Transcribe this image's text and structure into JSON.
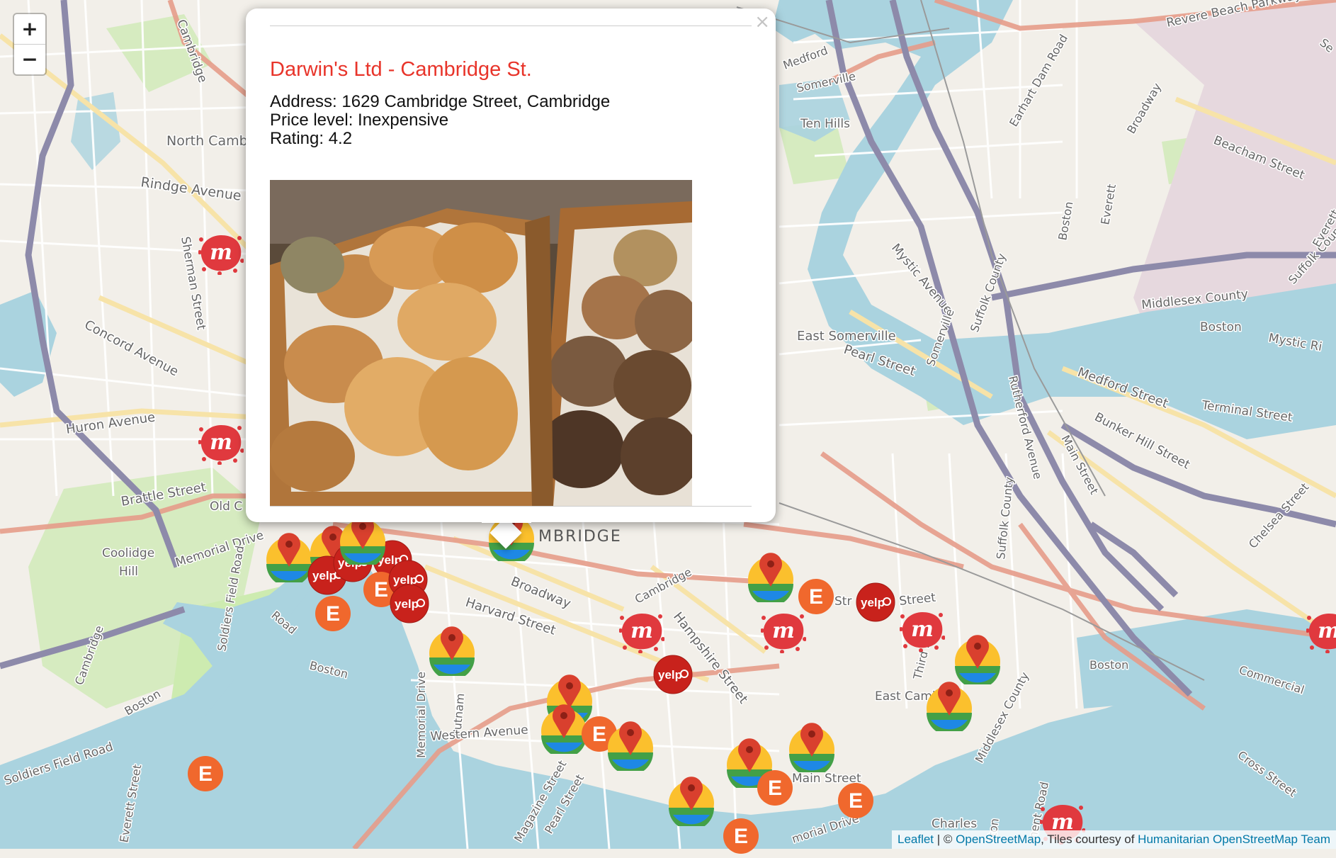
{
  "map": {
    "zoom_in_label": "+",
    "zoom_out_label": "−",
    "labels": {
      "cambridge_nw": "Cambridge",
      "north_cambridge": "North Camb",
      "rindge": "Rindge Avenue",
      "sherman": "Sherman Street",
      "concord": "Concord Avenue",
      "huron": "Huron Avenue",
      "brattle": "Brattle Street",
      "old_c": "Old C",
      "coolidge": "Coolidge\nHill",
      "memorial": "Memorial Drive",
      "soldiers_field_rd": "Soldiers Field Road",
      "soldiers_field_rd_bottom": "Soldiers Field Road",
      "cambridge_river": "Cambridge",
      "boston_river": "Boston",
      "boston_sw": "Boston",
      "everett_st": "Everett Street",
      "memorial_drive_v": "Memorial Drive",
      "putnam": "Putnam",
      "western": "Western Avenue",
      "magazine": "Magazine Street",
      "pearl_st": "Pearl Street",
      "harvard_st": "Harvard Street",
      "broadway": "Broadway",
      "hampshire": "Hampshire Street",
      "cambridge_st": "Cambridge",
      "cambridge_center": "MBRIDGE",
      "main_street": "Main Street",
      "charles": "Charles",
      "memorial_drive_b": "morial Drive",
      "east_cambridge": "East Camb",
      "third": "Third S",
      "medford": "Medford",
      "somerville": "Somerville",
      "ten_hills": "Ten Hills",
      "earhart": "Earhart Dam Road",
      "broadway_ne": "Broadway",
      "revere_beach": "Revere Beach Parkway",
      "beacham": "Beacham Street",
      "everett_ne": "Everett",
      "boston_ne": "Boston",
      "mystic_ave": "Mystic Avenue",
      "suffolk_county": "Suffolk County",
      "middlesex_county": "Middlesex County",
      "boston_mc": "Boston",
      "mystic_r": "Mystic Ri",
      "east_somerville": "East Somerville",
      "pearl_street": "Pearl Street",
      "somerville_v": "Somerville",
      "medford_street": "Medford Street",
      "terminal": "Terminal Street",
      "bunker_hill": "Bunker Hill Street",
      "rutherford": "Rutherford Avenue",
      "main_street_ne": "Main Street",
      "suffolk_county_2": "Suffolk County",
      "chelsea": "Chelsea Street",
      "boston_charles": "Boston",
      "middlesex_county_2": "Middlesex County",
      "commercial": "Commercial",
      "cross_street": "Cross Street",
      "street_top": "Street",
      "ment_road": "ment Road",
      "ston": "ston",
      "suffolk_right": "Suffolk Coun",
      "everett_right": "Everett",
      "se": "Se",
      "str": "Str",
      "c_street": "C     Street",
      "e_prefix": "E",
      "yelp": "yelp"
    },
    "colors": {
      "water": "#aad3df",
      "park": "#cdebb0",
      "land": "#f2efe9",
      "road": "#f7d9a8",
      "highway": "#8d8aaa",
      "primary": "#e69c8a"
    }
  },
  "popup": {
    "close": "×",
    "title": "Darwin's Ltd - Cambridge St.",
    "address": "Address: 1629 Cambridge Street, Cambridge",
    "price": "Price level: Inexpensive",
    "rating": "Rating: 4.2",
    "title_color": "#e8342a"
  },
  "markers": {
    "types": [
      "google-pin",
      "yelp",
      "eventbrite",
      "meetup"
    ],
    "yelp_label": "yelp",
    "eventbrite_label": "E",
    "meetup_label": "m"
  },
  "attribution": {
    "leaflet": "Leaflet",
    "separator": " | © ",
    "osm": "OpenStreetMap",
    "tiles": ", Tiles courtesy of ",
    "hot": "Humanitarian OpenStreetMap Team"
  }
}
